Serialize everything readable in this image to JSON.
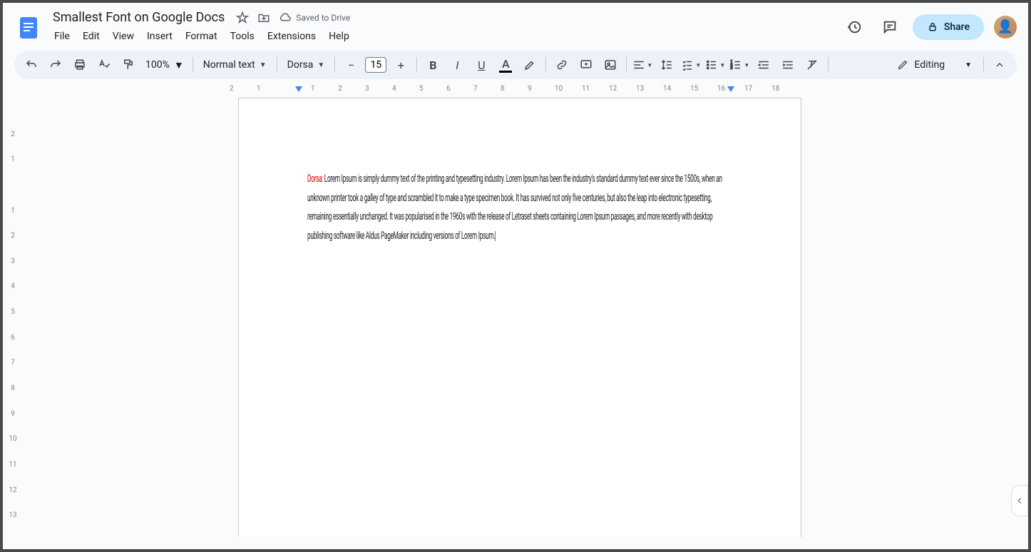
{
  "header": {
    "doc_title": "Smallest Font on Google Docs",
    "saved_status": "Saved to Drive",
    "menus": [
      "File",
      "Edit",
      "View",
      "Insert",
      "Format",
      "Tools",
      "Extensions",
      "Help"
    ],
    "share_label": "Share"
  },
  "toolbar": {
    "zoom": "100%",
    "style_select": "Normal text",
    "font_select": "Dorsa",
    "font_size": "15",
    "editing_label": "Editing"
  },
  "ruler_h": [
    "2",
    "1",
    "",
    "1",
    "2",
    "3",
    "4",
    "5",
    "6",
    "7",
    "8",
    "9",
    "10",
    "11",
    "12",
    "13",
    "14",
    "15",
    "16",
    "17",
    "18"
  ],
  "ruler_v": [
    "",
    "2",
    "1",
    "",
    "1",
    "2",
    "3",
    "4",
    "5",
    "6",
    "7",
    "8",
    "9",
    "10",
    "11",
    "12",
    "13"
  ],
  "document": {
    "font_label": "Dorsa:",
    "body_text": " Lorem Ipsum is simply dummy text of the printing and typesetting industry. Lorem Ipsum has been the industry's standard dummy text ever since the 1500s, when an unknown printer took a galley of type and scrambled it to make a type specimen book. It has survived not only five centuries, but also the leap into electronic typesetting, remaining essentially unchanged. It was popularised in the 1960s with the release of Letraset sheets containing Lorem Ipsum passages, and more recently with desktop publishing software like Aldus PageMaker including versions of Lorem Ipsum."
  }
}
